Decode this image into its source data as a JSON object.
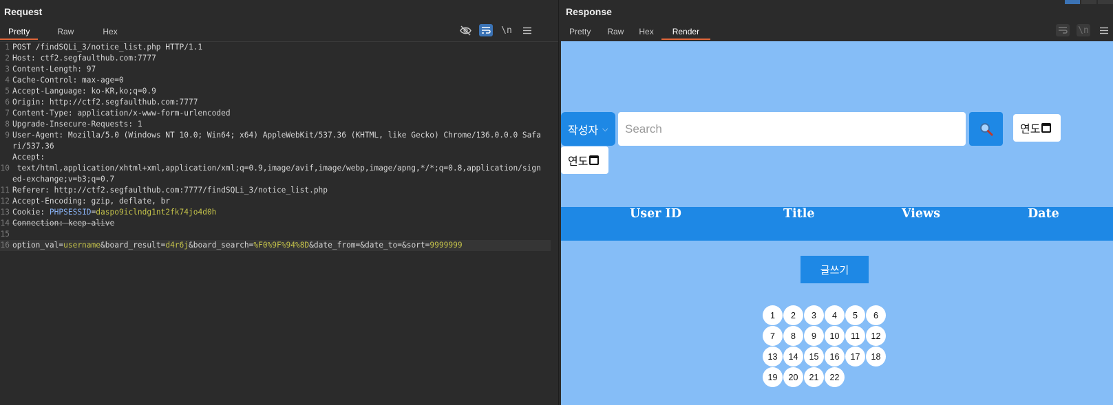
{
  "request": {
    "title": "Request",
    "tabs": [
      "Pretty",
      "Raw",
      "Hex"
    ],
    "active_tab": "Pretty",
    "toolbar": {
      "hide_icon": "eye-off-icon",
      "wrap_icon": "wrap-icon",
      "newline_label": "\\n",
      "menu_icon": "menu-icon"
    },
    "lines": [
      {
        "n": "1",
        "text": "POST /findSQLi_3/notice_list.php HTTP/1.1"
      },
      {
        "n": "2",
        "k": "Host",
        "v": " ctf2.segfaulthub.com:7777"
      },
      {
        "n": "3",
        "k": "Content-Length",
        "v": " 97"
      },
      {
        "n": "4",
        "k": "Cache-Control",
        "v": " max-age=0"
      },
      {
        "n": "5",
        "k": "Accept-Language",
        "v": " ko-KR,ko;q=0.9"
      },
      {
        "n": "6",
        "k": "Origin",
        "v": " http://ctf2.segfaulthub.com:7777"
      },
      {
        "n": "7",
        "k": "Content-Type",
        "v": " application/x-www-form-urlencoded"
      },
      {
        "n": "8",
        "k": "Upgrade-Insecure-Requests",
        "v": " 1"
      },
      {
        "n": "9",
        "k": "User-Agent",
        "v": " Mozilla/5.0 (Windows NT 10.0; Win64; x64) AppleWebKit/537.36 (KHTML, like Gecko) Chrome/136.0.0.0 Safari/537.36"
      },
      {
        "n": "10",
        "k": "Accept",
        "v": " text/html,application/xhtml+xml,application/xml;q=0.9,image/avif,image/webp,image/apng,*/*;q=0.8,application/signed-exchange;v=b3;q=0.7"
      },
      {
        "n": "11",
        "k": "Referer",
        "v": " http://ctf2.segfaulthub.com:7777/findSQLi_3/notice_list.php"
      },
      {
        "n": "12",
        "k": "Accept-Encoding",
        "v": " gzip, deflate, br"
      },
      {
        "n": "13",
        "k": "Cookie",
        "v": " "
      },
      {
        "n": "14",
        "k": "Connection",
        "v": " keep-alive"
      },
      {
        "n": "15",
        "text": ""
      },
      {
        "n": "16",
        "text": ""
      }
    ],
    "cookie": {
      "name": "PHPSESSID",
      "value": "daspo9iclndg1nt2fk74jo4d0h"
    },
    "body_params": [
      {
        "k": "option_val",
        "v": "username"
      },
      {
        "k": "board_result",
        "v": "d4r6j"
      },
      {
        "k": "board_search",
        "v": "%F0%9F%94%8D"
      },
      {
        "k": "date_from",
        "v": ""
      },
      {
        "k": "date_to",
        "v": ""
      },
      {
        "k": "sort",
        "v": "9999999"
      }
    ]
  },
  "response": {
    "title": "Response",
    "tabs": [
      "Pretty",
      "Raw",
      "Hex",
      "Render"
    ],
    "active_tab": "Render",
    "render": {
      "select_value": "작성자",
      "search_placeholder": "Search",
      "date_from_label": "연도",
      "date_to_label": "연도",
      "columns": [
        "User ID",
        "Title",
        "Views",
        "Date"
      ],
      "write_button": "글쓰기",
      "pages": [
        "1",
        "2",
        "3",
        "4",
        "5",
        "6",
        "7",
        "8",
        "9",
        "10",
        "11",
        "12",
        "13",
        "14",
        "15",
        "16",
        "17",
        "18",
        "19",
        "20",
        "21",
        "22"
      ]
    }
  },
  "colors": {
    "accent": "#1e88e5",
    "render_bg": "#85bdf7",
    "editor_bg": "#2b2b2b",
    "tab_underline": "#e0663a"
  }
}
